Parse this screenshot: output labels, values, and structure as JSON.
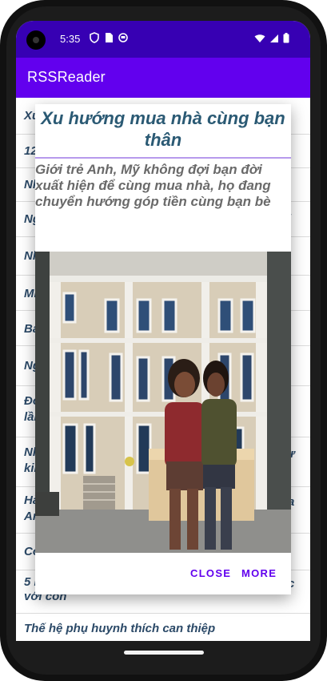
{
  "status_bar": {
    "time": "5:35",
    "left_icons": [
      "shield-icon",
      "sim-card-icon",
      "notification-icon"
    ],
    "right_icons": [
      "wifi-icon",
      "cellular-signal-icon",
      "battery-icon"
    ]
  },
  "app_bar": {
    "title": "RSSReader",
    "color": "#6200EE",
    "status_color": "#3700B3"
  },
  "list": {
    "items": [
      {
        "text": "Xu"
      },
      {
        "text": "12"
      },
      {
        "text": "Nh"
      },
      {
        "text": "Ng"
      },
      {
        "text": "Nh"
      },
      {
        "text": "Mi"
      },
      {
        "text": "Ba"
      },
      {
        "text": "Ng"
      },
      {
        "text": "Đo",
        "line2": "lần"
      },
      {
        "text": "Nh",
        "line2": "kin"
      },
      {
        "text": "Hà",
        "line2": "An"
      },
      {
        "text": "Cơ"
      },
      {
        "text": "5 l",
        "line2": "với con"
      },
      {
        "text": "Thế hệ phụ huynh thích can thiệp"
      }
    ],
    "right_fragments": [
      {
        "text": "i"
      },
      {
        "text": "ự"
      },
      {
        "text": "a"
      },
      {
        "text": "c"
      }
    ]
  },
  "dialog": {
    "title": "Xu hướng mua nhà cùng bạn thân",
    "description": "Giới trẻ Anh, Mỹ không đợi bạn đời xuất hiện để cùng mua nhà, họ đang chuyển hướng góp tiền cùng bạn bè",
    "image_alt": "two-women-sitting-in-front-of-townhouse",
    "close_label": "CLOSE",
    "more_label": "MORE"
  }
}
